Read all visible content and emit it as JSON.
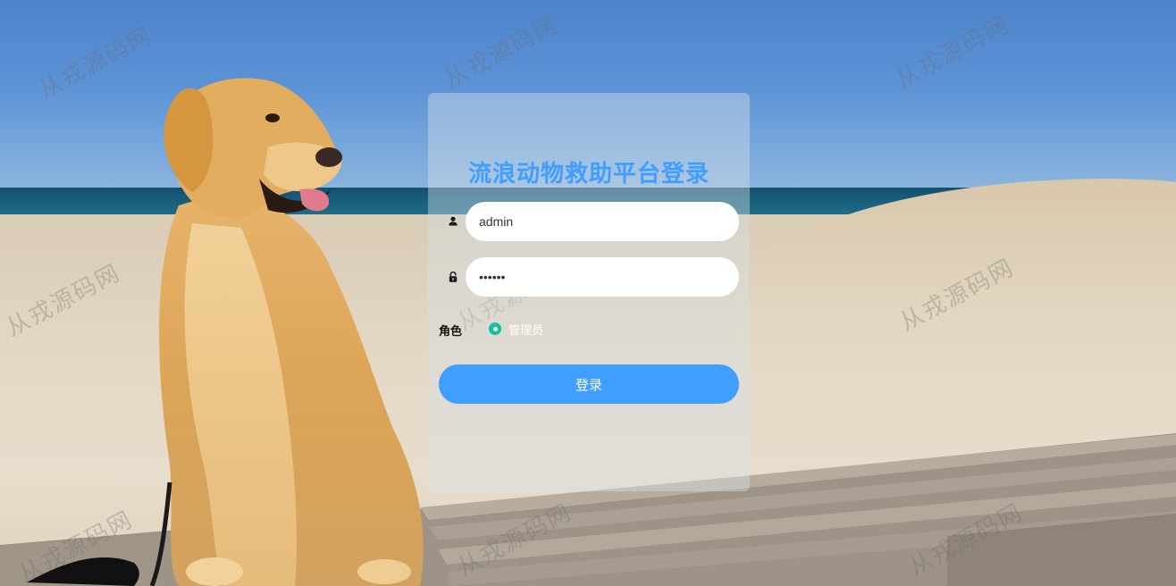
{
  "login": {
    "title": "流浪动物救助平台登录",
    "username": {
      "value": "admin",
      "icon": "user-icon"
    },
    "password": {
      "value": "123456",
      "icon": "lock-icon"
    },
    "role": {
      "label": "角色",
      "options": [
        "管理员"
      ],
      "selected": "管理员"
    },
    "submit_label": "登录"
  },
  "watermark_text": "从戎源码网",
  "colors": {
    "accent": "#409eff",
    "radio_selected": "#13c29b",
    "panel": "rgba(215,225,230,0.42)"
  }
}
